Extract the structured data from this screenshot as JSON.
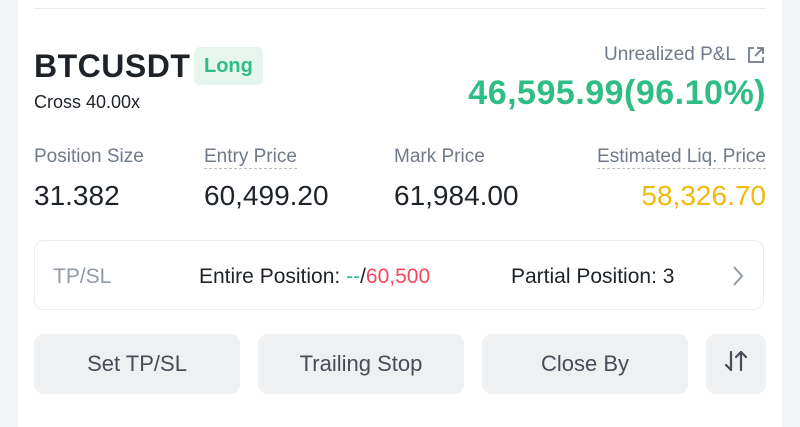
{
  "position": {
    "symbol": "BTCUSDT",
    "side": "Long",
    "margin_mode": "Cross 40.00x",
    "unrealized_pnl_label": "Unrealized P&L",
    "unrealized_pnl_value": "46,595.99(96.10%)"
  },
  "stats": {
    "position_size_label": "Position Size",
    "position_size_value": "31.382",
    "entry_price_label": "Entry Price",
    "entry_price_value": "60,499.20",
    "mark_price_label": "Mark Price",
    "mark_price_value": "61,984.00",
    "liq_price_label": "Estimated Liq. Price",
    "liq_price_value": "58,326.70"
  },
  "tpsl": {
    "label": "TP/SL",
    "entire_label": "Entire Position: ",
    "tp_value": "--",
    "separator": "/",
    "sl_value": "60,500",
    "partial_label": "Partial Position: 3"
  },
  "actions": {
    "set_tpsl": "Set TP/SL",
    "trailing_stop": "Trailing Stop",
    "close_by": "Close By"
  },
  "colors": {
    "profit": "#2ebd85",
    "loss": "#f6465d",
    "liquidation": "#f0b90b",
    "badge_bg": "#e6f6ee"
  },
  "icons": {
    "pnl_share": "external-link-icon",
    "tpsl_detail": "chevron-right-icon",
    "reverse": "swap-vertical-icon"
  }
}
